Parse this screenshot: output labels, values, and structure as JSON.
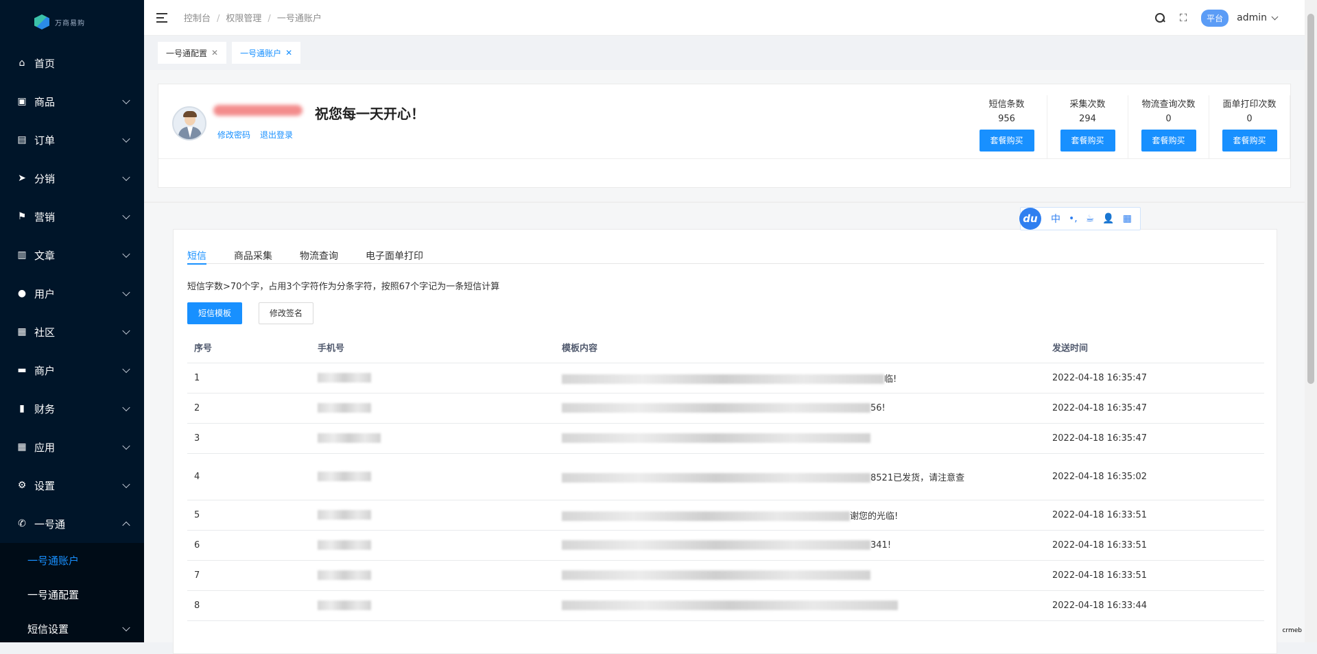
{
  "sidebar": {
    "logo_text": "万商易购",
    "items": [
      {
        "label": "首页",
        "icon": "home-icon",
        "glyph": "⌂"
      },
      {
        "label": "商品",
        "icon": "shop-bag-icon",
        "glyph": "▣"
      },
      {
        "label": "订单",
        "icon": "order-icon",
        "glyph": "▤"
      },
      {
        "label": "分销",
        "icon": "send-icon",
        "glyph": "➤"
      },
      {
        "label": "营销",
        "icon": "flag-icon",
        "glyph": "⚑"
      },
      {
        "label": "文章",
        "icon": "article-icon",
        "glyph": "▥"
      },
      {
        "label": "用户",
        "icon": "user-icon",
        "glyph": "●"
      },
      {
        "label": "社区",
        "icon": "community-icon",
        "glyph": "▦"
      },
      {
        "label": "商户",
        "icon": "merchant-icon",
        "glyph": "▬"
      },
      {
        "label": "财务",
        "icon": "finance-icon",
        "glyph": "▮"
      },
      {
        "label": "应用",
        "icon": "apps-icon",
        "glyph": "▦"
      },
      {
        "label": "设置",
        "icon": "gear-icon",
        "glyph": "⚙"
      },
      {
        "label": "一号通",
        "icon": "phone-icon",
        "glyph": "✆"
      }
    ],
    "sub_items": [
      {
        "label": "一号通账户"
      },
      {
        "label": "一号通配置"
      },
      {
        "label": "短信设置"
      }
    ]
  },
  "header": {
    "breadcrumb": [
      "控制台",
      "权限管理",
      "一号通账户"
    ],
    "platform_tag": "平台",
    "user": "admin"
  },
  "tags": [
    {
      "label": "一号通配置"
    },
    {
      "label": "一号通账户"
    }
  ],
  "account": {
    "greeting": "祝您每一天开心！",
    "links": [
      "修改密码",
      "退出登录"
    ],
    "stats": [
      {
        "label": "短信条数",
        "value": "956",
        "button": "套餐购买"
      },
      {
        "label": "采集次数",
        "value": "294",
        "button": "套餐购买"
      },
      {
        "label": "物流查询次数",
        "value": "0",
        "button": "套餐购买"
      },
      {
        "label": "面单打印次数",
        "value": "0",
        "button": "套餐购买"
      }
    ]
  },
  "ime": {
    "logo": "du",
    "items": [
      "中",
      "•,",
      "☕",
      "👤",
      "▦"
    ]
  },
  "panel": {
    "tabs": [
      "短信",
      "商品采集",
      "物流查询",
      "电子面单打印"
    ],
    "tip": "短信字数>70个字，占用3个字符作为分条字符，按照67个字记为一条短信计算",
    "btn_template": "短信模板",
    "btn_sign": "修改签名",
    "table": {
      "headers": [
        "序号",
        "手机号",
        "模板内容",
        "发送时间"
      ],
      "rows": [
        {
          "no": "1",
          "content_tail": "临!",
          "time": "2022-04-18 16:35:47"
        },
        {
          "no": "2",
          "content_tail": "56!",
          "time": "2022-04-18 16:35:47"
        },
        {
          "no": "3",
          "content_tail": "",
          "time": "2022-04-18 16:35:47"
        },
        {
          "no": "4",
          "content_tail": "8521已发货，请注意查",
          "time": "2022-04-18 16:35:02"
        },
        {
          "no": "5",
          "content_tail": "谢您的光临!",
          "time": "2022-04-18 16:33:51"
        },
        {
          "no": "6",
          "content_tail": "341!",
          "time": "2022-04-18 16:33:51"
        },
        {
          "no": "7",
          "content_tail": "",
          "time": "2022-04-18 16:33:51"
        },
        {
          "no": "8",
          "content_tail": "",
          "time": "2022-04-18 16:33:44"
        }
      ]
    }
  },
  "corner_text": "crmeb"
}
